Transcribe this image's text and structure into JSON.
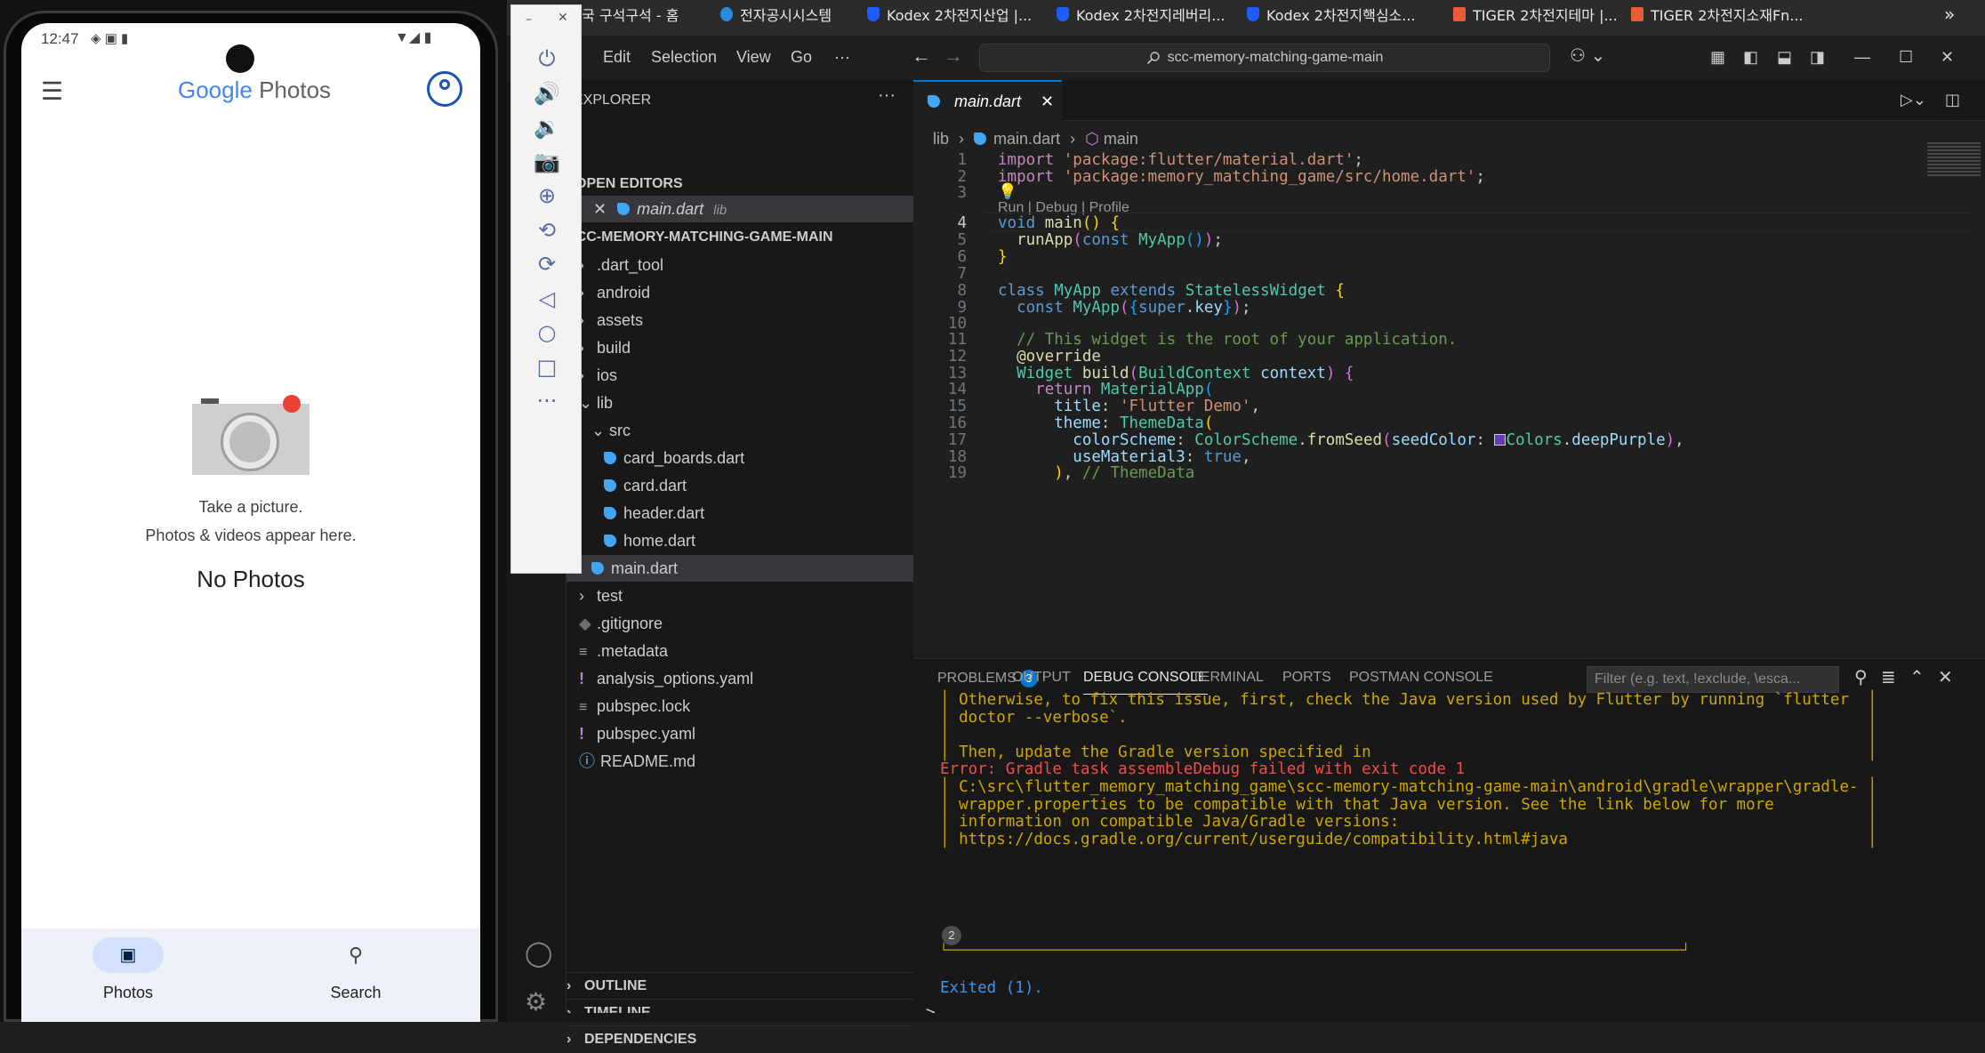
{
  "bookmarks": [
    {
      "label": "대한민국 구석구석 - 홈"
    },
    {
      "label": "전자공시시스템"
    },
    {
      "label": "Kodex 2차전지산업 |..."
    },
    {
      "label": "Kodex 2차전지레버리..."
    },
    {
      "label": "Kodex 2차전지핵심소..."
    },
    {
      "label": "TIGER 2차전지테마 |..."
    },
    {
      "label": "TIGER 2차전지소재Fn..."
    },
    {
      "label": "»"
    }
  ],
  "phone": {
    "status_time": "12:47",
    "app_name": {
      "google": "Google",
      "photos": "Photos"
    },
    "empty_line1": "Take a picture.",
    "empty_line2": "Photos & videos appear here.",
    "empty_title": "No Photos",
    "nav": {
      "photos": "Photos",
      "search": "Search"
    }
  },
  "emulator": {
    "buttons": [
      "power-icon",
      "volume-up-icon",
      "volume-down-icon",
      "camera-icon",
      "zoom-icon",
      "rotate-left-icon",
      "rotate-right-icon",
      "back-icon",
      "home-icon",
      "overview-icon",
      "more-icon"
    ]
  },
  "vscode": {
    "menu": [
      "Edit",
      "Selection",
      "View",
      "Go",
      "···"
    ],
    "command_center": "scc-memory-matching-game-main",
    "explorer": {
      "title": "EXPLORER",
      "open_editors": "OPEN EDITORS",
      "open_file": "main.dart",
      "open_file_dir": "lib",
      "project": "SCC-MEMORY-MATCHING-GAME-MAIN",
      "tree": [
        {
          "label": ".dart_tool",
          "kind": "folder",
          "depth": 0
        },
        {
          "label": "android",
          "kind": "folder",
          "depth": 0
        },
        {
          "label": "assets",
          "kind": "folder",
          "depth": 0
        },
        {
          "label": "build",
          "kind": "folder",
          "depth": 0
        },
        {
          "label": "ios",
          "kind": "folder",
          "depth": 0
        },
        {
          "label": "lib",
          "kind": "open-folder",
          "depth": 0
        },
        {
          "label": "src",
          "kind": "open-folder",
          "depth": 1
        },
        {
          "label": "card_boards.dart",
          "kind": "dart",
          "depth": 2
        },
        {
          "label": "card.dart",
          "kind": "dart",
          "depth": 2
        },
        {
          "label": "header.dart",
          "kind": "dart",
          "depth": 2
        },
        {
          "label": "home.dart",
          "kind": "dart",
          "depth": 2
        },
        {
          "label": "main.dart",
          "kind": "dart",
          "depth": 1
        },
        {
          "label": "test",
          "kind": "folder",
          "depth": 0
        },
        {
          "label": ".gitignore",
          "kind": "git",
          "depth": 0
        },
        {
          "label": ".metadata",
          "kind": "txt",
          "depth": 0
        },
        {
          "label": "analysis_options.yaml",
          "kind": "yaml",
          "depth": 0
        },
        {
          "label": "pubspec.lock",
          "kind": "txt",
          "depth": 0
        },
        {
          "label": "pubspec.yaml",
          "kind": "yaml",
          "depth": 0
        },
        {
          "label": "README.md",
          "kind": "info",
          "depth": 0
        }
      ],
      "outline": "OUTLINE",
      "timeline": "TIMELINE",
      "dependencies": "DEPENDENCIES"
    },
    "tab": "main.dart",
    "breadcrumb": {
      "folder": "lib",
      "file": "main.dart",
      "symbol": "main"
    },
    "codelens": "Run | Debug | Profile",
    "line_numbers": [
      "1",
      "2",
      "3",
      "4",
      "5",
      "6",
      "7",
      "8",
      "9",
      "10",
      "11",
      "12",
      "13",
      "14",
      "15",
      "16",
      "17",
      "18",
      "19"
    ],
    "code_text": {
      "l1_kw": "import",
      "l1_str": "'package:flutter/material.dart'",
      "l1_end": ";",
      "l2_kw": "import",
      "l2_str": "'package:memory_matching_game/src/home.dart'",
      "l2_end": ";",
      "l4_kw": "void",
      "l4_fn": "main",
      "l4_rest": "() {",
      "l5_fn": "runApp",
      "l5_kw": "const",
      "l5_cls": "MyApp",
      "l5_rest": "());",
      "l6": "}",
      "l8_kw": "class",
      "l8_cls": "MyApp",
      "l8_kw2": "extends",
      "l8_cls2": "StatelessWidget",
      "l8_rest": "{",
      "l9_kw": "const",
      "l9_cls": "MyApp",
      "l9_kw2": "super",
      "l9_prm": "key",
      "l11": "// This widget is the root of your application.",
      "l12": "@override",
      "l13_cls": "Widget",
      "l13_fn": "build",
      "l13_cls2": "BuildContext",
      "l13_prm": "context",
      "l14_kw": "return",
      "l14_cls": "MaterialApp",
      "l15_prm": "title",
      "l15_str": "'Flutter Demo'",
      "l16_prm": "theme",
      "l16_cls": "ThemeData",
      "l17_prm": "colorScheme",
      "l17_cls": "ColorScheme",
      "l17_fn": "fromSeed",
      "l17_prm2": "seedColor",
      "l17_cls2": "Colors",
      "l17_prm3": "deepPurple",
      "l18_prm": "useMaterial3",
      "l18_kw": "true",
      "l19_cmt": "// ThemeData"
    },
    "panel": {
      "tabs": [
        "PROBLEMS",
        "OUTPUT",
        "DEBUG CONSOLE",
        "TERMINAL",
        "PORTS",
        "POSTMAN CONSOLE"
      ],
      "problems_count": "3",
      "filter_placeholder": "Filter (e.g. text, !exclude, \\esca...",
      "lines": [
        "│ Otherwise, to fix this issue, first, check the Java version used by Flutter by running `flutter  │",
        "│ doctor --verbose`.                                                                               │",
        "│                                                                                                  │",
        "│ Then, update the Gradle version specified in                                                     │",
        "Error: Gradle task assembleDebug failed with exit code 1",
        "│ C:\\src\\flutter_memory_matching_game\\scc-memory-matching-game-main\\android\\gradle\\wrapper\\gradle- │",
        "│ wrapper.properties to be compatible with that Java version. See the link below for more          │",
        "│ information on compatible Java/Gradle versions:                                                  │",
        "│ https://docs.gradle.org/current/userguide/compatibility.html#java                                │"
      ],
      "repeat_count": "2",
      "bottom_border": "└──────────────────────────────────────────────────────────────────────────────────────────────────┘",
      "exited": "Exited (1).",
      "prompt": ">"
    }
  }
}
